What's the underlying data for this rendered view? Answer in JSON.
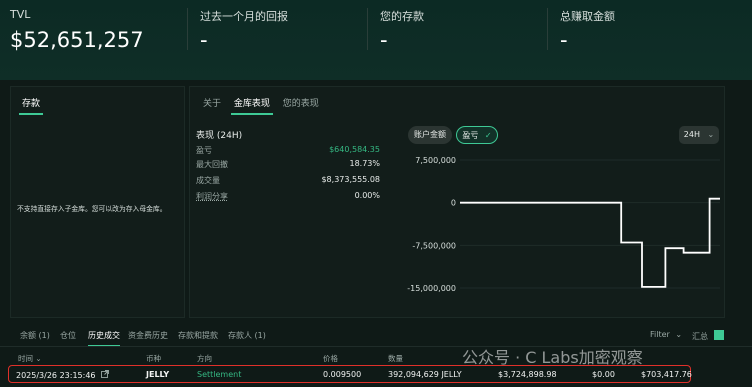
{
  "header": {
    "tvl_label": "TVL",
    "tvl_value": "$52,651,257",
    "return_label": "过去一个月的回报",
    "return_value": "-",
    "deposit_label": "您的存款",
    "deposit_value": "-",
    "earned_label": "总赚取金额",
    "earned_value": "-"
  },
  "left_panel": {
    "tab": "存款",
    "message": "不支持直接存入子金库。您可以改为存入母金库。"
  },
  "right_panel": {
    "tabs": [
      "关于",
      "金库表现",
      "您的表现"
    ],
    "perf_title": "表现 (24H)",
    "rows": [
      {
        "label": "盈亏",
        "value": "$640,584.35"
      },
      {
        "label": "最大回撤",
        "value": "18.73%"
      },
      {
        "label": "成交量",
        "value": "$8,373,555.08"
      },
      {
        "label": "利润分享",
        "value": "0.00%"
      }
    ],
    "pills": {
      "account_value": "账户金额",
      "pnl": "盈亏",
      "check_icon": "✓"
    },
    "range": {
      "value": "24H",
      "chevron": "⌄"
    }
  },
  "chart_data": {
    "type": "line",
    "y_ticks": [
      "7,500,000",
      "0",
      "-7,500,000",
      "-15,000,000"
    ],
    "ylim": [
      -15000000,
      7500000
    ],
    "points": [
      [
        0,
        0
      ],
      [
        0.62,
        0
      ],
      [
        0.62,
        -7000000
      ],
      [
        0.7,
        -7000000
      ],
      [
        0.7,
        -14800000
      ],
      [
        0.79,
        -14800000
      ],
      [
        0.79,
        -8000000
      ],
      [
        0.86,
        -8000000
      ],
      [
        0.86,
        -8800000
      ],
      [
        0.96,
        -8800000
      ],
      [
        0.96,
        700000
      ],
      [
        1.0,
        700000
      ]
    ],
    "line_color": "#ffffff",
    "grid": true
  },
  "bottom": {
    "tabs": [
      "余额 (1)",
      "仓位",
      "历史成交",
      "资金费历史",
      "存款和提款",
      "存款人 (1)"
    ],
    "active_tab": "历史成交",
    "filter_label": "Filter",
    "filter_chevron": "⌄",
    "summary_label": "汇总",
    "columns": [
      "时间",
      "币种",
      "方向",
      "价格",
      "数量",
      "",
      "",
      ""
    ],
    "time_sort_icon": "⌄",
    "row": {
      "time": "2025/3/26 23:15:46",
      "coin": "JELLY",
      "direction": "Settlement",
      "price": "0.009500",
      "size": "392,094,629 JELLY",
      "value": "$3,724,898.98",
      "fee": "$0.00",
      "pnl": "$703,417.76"
    }
  },
  "watermark": "公众号 · C Labs加密观察"
}
